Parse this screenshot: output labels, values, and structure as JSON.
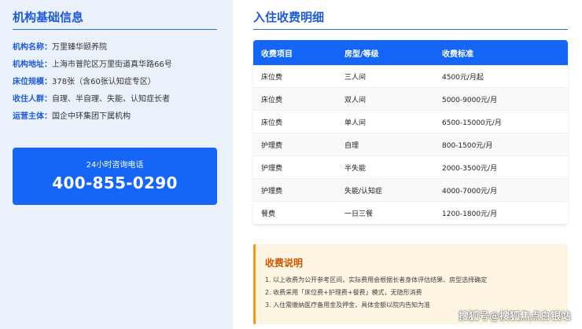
{
  "left_panel": {
    "title": "机构基础信息",
    "info": [
      {
        "label": "机构名称：",
        "value": "万里臻华颐养院"
      },
      {
        "label": "机构地址：",
        "value": "上海市普陀区万里街道真华路66号"
      },
      {
        "label": "床位规模：",
        "value": "378张（含60张认知症专区）"
      },
      {
        "label": "收住人群：",
        "value": "自理、半自理、失能、认知症长者"
      },
      {
        "label": "运营主体：",
        "value": "国企中环集团下属机构"
      }
    ],
    "phone": {
      "label": "24小时咨询电话",
      "number": "400-855-0290"
    }
  },
  "right_panel": {
    "title": "入住收费明细",
    "table": {
      "headers": [
        "收费项目",
        "房型/等级",
        "收费标准"
      ],
      "rows": [
        [
          "床位费",
          "三人间",
          "4500元/月起"
        ],
        [
          "床位费",
          "双人间",
          "5000-9000元/月"
        ],
        [
          "床位费",
          "单人间",
          "6500-15000元/月"
        ],
        [
          "护理费",
          "自理",
          "800-1500元/月"
        ],
        [
          "护理费",
          "半失能",
          "2000-3500元/月"
        ],
        [
          "护理费",
          "失能/认知症",
          "4000-7000元/月"
        ],
        [
          "餐费",
          "一日三餐",
          "1200-1800元/月"
        ]
      ]
    },
    "note": {
      "title": "收费说明",
      "items": [
        "1. 以上收费为公开参考区间，实际费用会根据长者身体评估结果、房型选择确定",
        "2. 收费采用「床位费+护理费+餐费」模式，无隐形消费",
        "3. 入住需缴纳医疗备用金及押金，具体金额以院内告知为准"
      ]
    }
  },
  "watermark": "搜狐号@搜狐焦点白银站",
  "colors": {
    "accent": "#1565f6",
    "title": "#1e5bd8",
    "note_bg": "#fdf5e2",
    "note_border": "#f39c12",
    "note_title": "#d35400"
  }
}
